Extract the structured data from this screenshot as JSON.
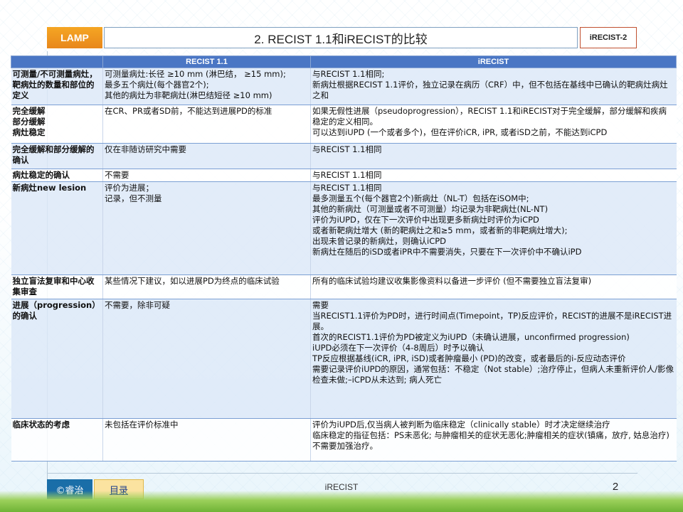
{
  "header": {
    "logo": "LAMP",
    "title": "2. RECIST 1.1和iRECIST的比较",
    "tag": "iRECIST-2"
  },
  "table": {
    "headers": [
      "",
      "RECIST 1.1",
      "iRECIST"
    ],
    "rows": [
      {
        "label": [
          "可测量/不可测量病灶，靶病灶的数量和部位的定义"
        ],
        "recist": [
          "可测量病灶:长径 ≥10 mm (淋巴结， ≥15 mm);",
          "最多五个病灶(每个器官2个);",
          "其他的病灶为非靶病灶(淋巴结短径 ≥10 mm)"
        ],
        "irecist": [
          "与RECIST 1.1相同;",
          "新病灶根据RECIST 1.1评价，独立记录在病历（CRF）中，但不包括在基线中已确认的靶病灶病灶之和"
        ]
      },
      {
        "label": [
          "完全缓解",
          "部分缓解",
          "病灶稳定"
        ],
        "recist": [
          "在CR、PR或者SD前，不能达到进展PD的标准"
        ],
        "irecist": [
          "如果无假性进展（pseudoprogression），RECIST 1.1和iRECIST对于完全缓解，部分缓解和疾病稳定的定义相同。",
          "可以达到iUPD (一个或者多个)，但在评价iCR, iPR, 或者iSD之前，不能达到iCPD"
        ]
      },
      {
        "label": [
          "完全缓解和部分缓解的确认"
        ],
        "recist": [
          "仅在非随访研究中需要"
        ],
        "irecist": [
          "与RECIST 1.1相同"
        ]
      },
      {
        "label": [
          "病灶稳定的确认"
        ],
        "recist": [
          "不需要"
        ],
        "irecist": [
          "与RECIST 1.1相同"
        ]
      },
      {
        "label": [
          "新病灶new lesion"
        ],
        "recist": [
          "评价为进展；",
          "记录，但不测量"
        ],
        "irecist": [
          "与RECIST 1.1相同",
          "最多测量五个(每个器官2个)新病灶（NL-T）包括在iSOM中;",
          "其他的新病灶（可测量或者不可测量）均记录为非靶病灶(NL-NT)",
          "评价为iUPD，仅在下一次评价中出现更多新病灶时评价为iCPD",
          "或者新靶病灶增大 (新的靶病灶之和≥5 mm，或者新的非靶病灶增大);",
          "出现未曾记录的新病灶，则确认iCPD",
          "新病灶在随后的iSD或者iPR中不需要消失，只要在下一次评价中不确认iPD"
        ]
      },
      {
        "label": [
          "独立盲法复审和中心收集审查"
        ],
        "recist": [
          "某些情况下建议，如以进展PD为终点的临床试验"
        ],
        "irecist": [
          "所有的临床试验均建议收集影像资料以备进一步评价 (但不需要独立盲法复审)"
        ]
      },
      {
        "label": [
          "进展（progression）的确认"
        ],
        "recist": [
          "不需要，除非可疑"
        ],
        "irecist": [
          "需要",
          "当RECIST1.1评价为PD时，进行时间点(Timepoint，TP)反应评价，RECIST的进展不是iRECIST进展。",
          "首次的RECIST1.1评价为PD被定义为iUPD（未确认进展，unconfirmed progression)",
          "iUPD必须在下一次评价（4-8周后）时予以确认",
          "TP反应根据基线(iCR, iPR, iSD)或者肿瘤最小 (PD)的改变，或者最后的i-反应动态评价",
          "需要记录评价iUPD的原因，通常包括：不稳定（Not stable）;治疗停止，但病人未重新评价人/影像检查未做;–iCPD从未达到; 病人死亡"
        ]
      },
      {
        "label": [
          "临床状态的考虑"
        ],
        "recist": [
          "未包括在评价标准中"
        ],
        "irecist": [
          "评价为iUPD后,仅当病人被判断为临床稳定（clinically stable）时才决定继续治疗",
          "临床稳定的指征包括：PS未恶化; 与肿瘤相关的症状无恶化;肿瘤相关的症状(镇痛，放疗, 姑息治疗)不需要加强治疗。"
        ]
      }
    ]
  },
  "footer": {
    "brand": "©睿治",
    "toc": "目录",
    "center": "iRECIST",
    "page": "2"
  },
  "colors": {
    "header_blue": "#4a76c4",
    "logo_orange": "#f5a623",
    "brand_blue": "#1a6ea8"
  }
}
